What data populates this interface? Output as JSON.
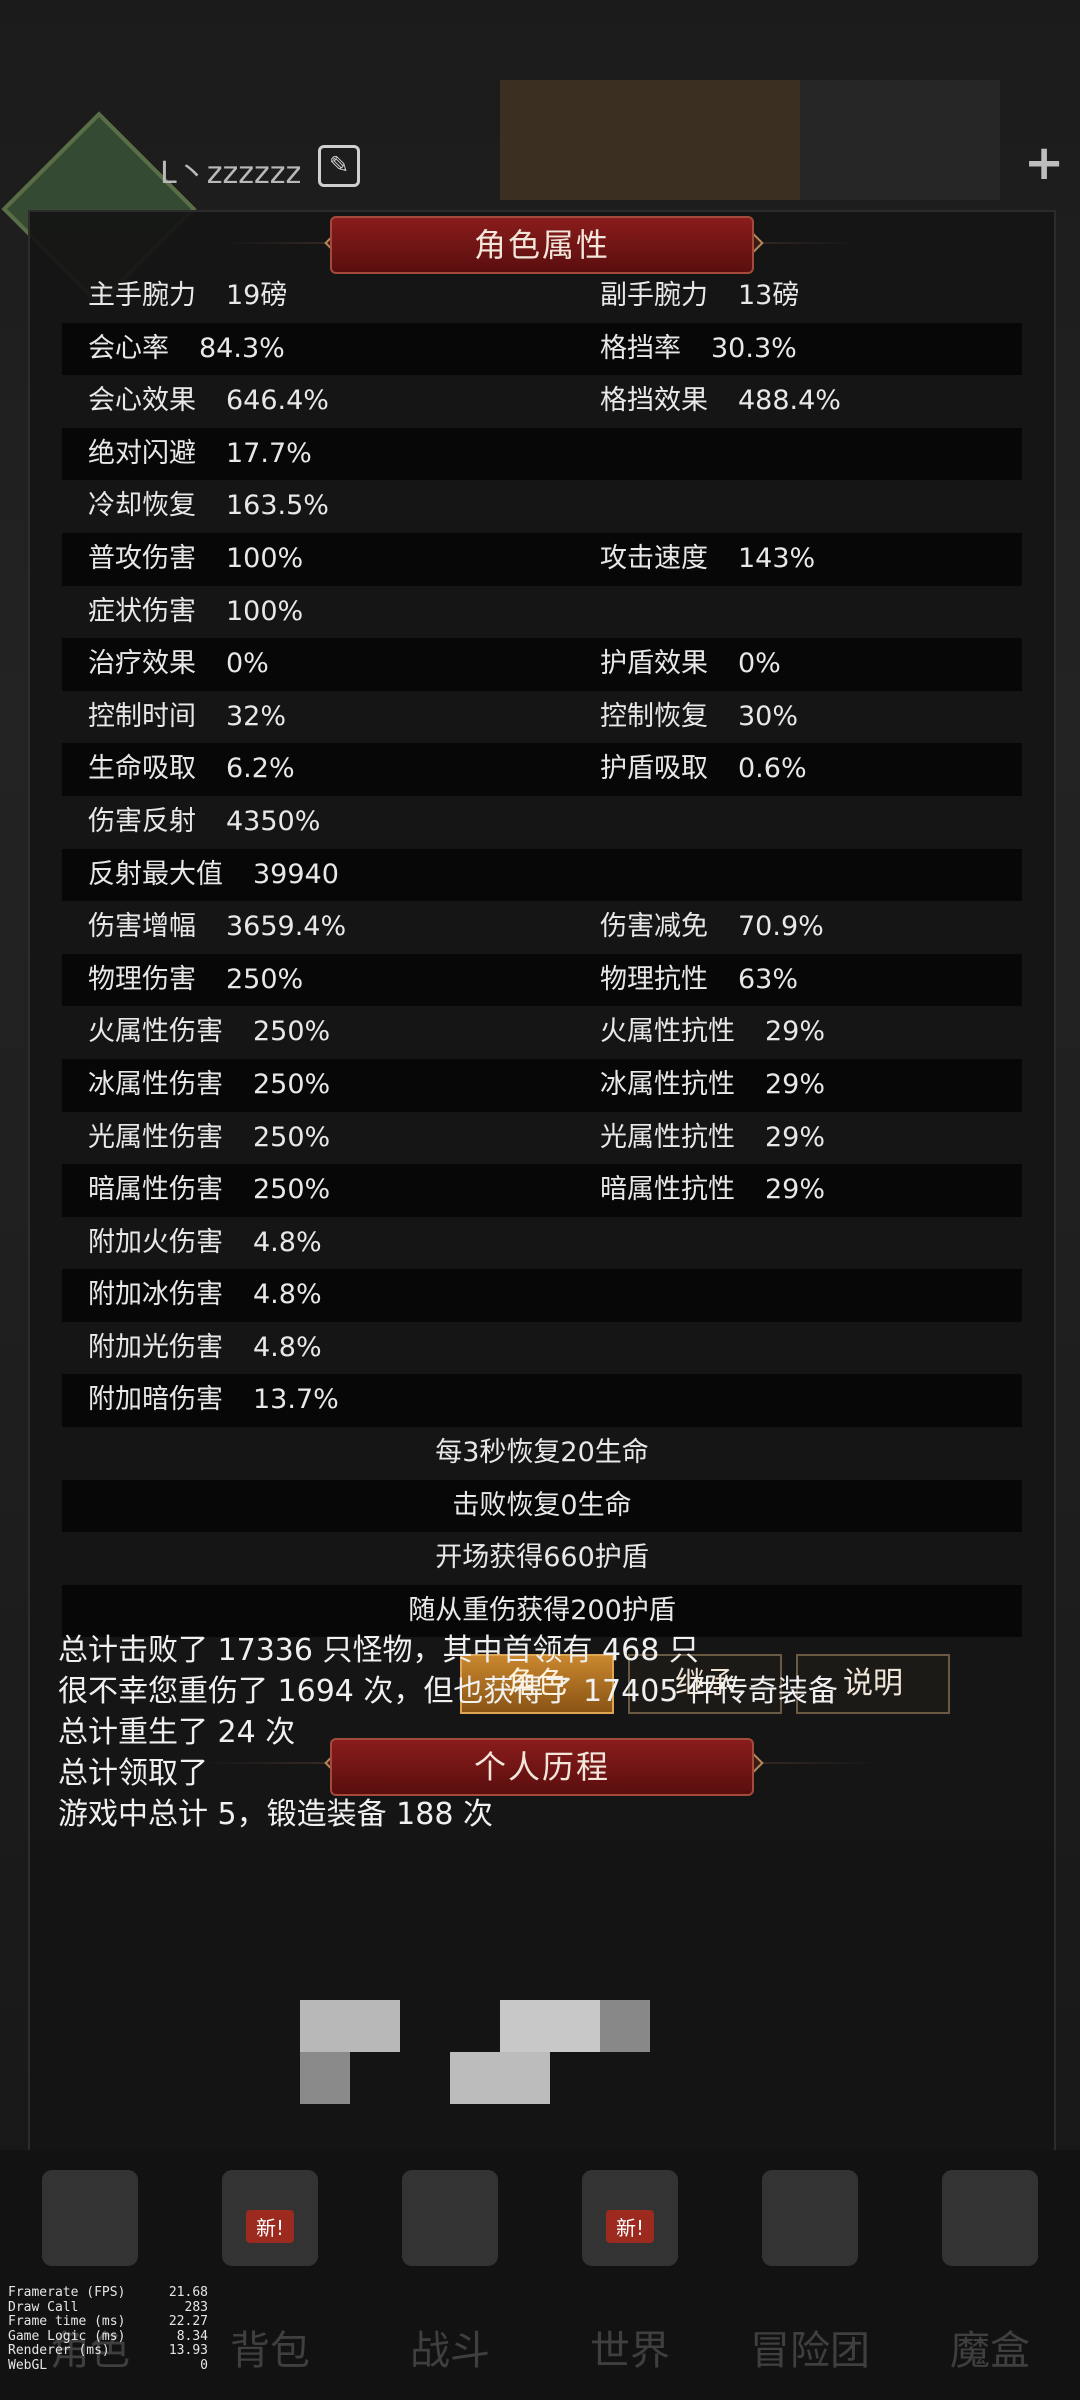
{
  "header": {
    "player_name": "L丶zzzzzz"
  },
  "attributes_panel": {
    "title": "角色属性",
    "rows": [
      {
        "l_label": "主手腕力",
        "l_val": "19磅",
        "r_label": "副手腕力",
        "r_val": "13磅"
      },
      {
        "l_label": "会心率",
        "l_val": "84.3%",
        "r_label": "格挡率",
        "r_val": "30.3%"
      },
      {
        "l_label": "会心效果",
        "l_val": "646.4%",
        "r_label": "格挡效果",
        "r_val": "488.4%"
      },
      {
        "l_label": "绝对闪避",
        "l_val": "17.7%",
        "r_label": "",
        "r_val": ""
      },
      {
        "l_label": "冷却恢复",
        "l_val": "163.5%",
        "r_label": "",
        "r_val": ""
      },
      {
        "l_label": "普攻伤害",
        "l_val": "100%",
        "r_label": "攻击速度",
        "r_val": "143%"
      },
      {
        "l_label": "症状伤害",
        "l_val": "100%",
        "r_label": "",
        "r_val": ""
      },
      {
        "l_label": "治疗效果",
        "l_val": "0%",
        "r_label": "护盾效果",
        "r_val": "0%"
      },
      {
        "l_label": "控制时间",
        "l_val": "32%",
        "r_label": "控制恢复",
        "r_val": "30%"
      },
      {
        "l_label": "生命吸取",
        "l_val": "6.2%",
        "r_label": "护盾吸取",
        "r_val": "0.6%"
      },
      {
        "l_label": "伤害反射",
        "l_val": "4350%",
        "r_label": "",
        "r_val": ""
      },
      {
        "l_label": "反射最大值",
        "l_val": "39940",
        "r_label": "",
        "r_val": ""
      },
      {
        "l_label": "伤害增幅",
        "l_val": "3659.4%",
        "r_label": "伤害减免",
        "r_val": "70.9%"
      },
      {
        "l_label": "物理伤害",
        "l_val": "250%",
        "r_label": "物理抗性",
        "r_val": "63%"
      },
      {
        "l_label": "火属性伤害",
        "l_val": "250%",
        "r_label": "火属性抗性",
        "r_val": "29%"
      },
      {
        "l_label": "冰属性伤害",
        "l_val": "250%",
        "r_label": "冰属性抗性",
        "r_val": "29%"
      },
      {
        "l_label": "光属性伤害",
        "l_val": "250%",
        "r_label": "光属性抗性",
        "r_val": "29%"
      },
      {
        "l_label": "暗属性伤害",
        "l_val": "250%",
        "r_label": "暗属性抗性",
        "r_val": "29%"
      },
      {
        "l_label": "附加火伤害",
        "l_val": "4.8%",
        "r_label": "",
        "r_val": ""
      },
      {
        "l_label": "附加冰伤害",
        "l_val": "4.8%",
        "r_label": "",
        "r_val": ""
      },
      {
        "l_label": "附加光伤害",
        "l_val": "4.8%",
        "r_label": "",
        "r_val": ""
      },
      {
        "l_label": "附加暗伤害",
        "l_val": "13.7%",
        "r_label": "",
        "r_val": ""
      }
    ],
    "centered_rows": [
      "每3秒恢复20生命",
      "击败恢复0生命",
      "开场获得660护盾",
      "随从重伤获得200护盾"
    ]
  },
  "tabs": [
    {
      "label": "角色",
      "active": true
    },
    {
      "label": "继承",
      "active": false
    },
    {
      "label": "说明",
      "active": false
    }
  ],
  "history": {
    "title": "个人历程",
    "lines": [
      "总计击败了 17336 只怪物，其中首领有 468 只",
      "很不幸您重伤了 1694 次，但也获得了 17405 件传奇装备",
      "总计重生了 24 次",
      "总计领取了",
      "游戏中总计                     5，锻造装备 188 次"
    ]
  },
  "bottom_nav": [
    {
      "label": "角色",
      "icon": "helmet-icon",
      "badge": ""
    },
    {
      "label": "背包",
      "icon": "backpack-icon",
      "badge": "新!"
    },
    {
      "label": "战斗",
      "icon": "sword-shield-icon",
      "badge": ""
    },
    {
      "label": "世界",
      "icon": "scroll-map-icon",
      "badge": "新!"
    },
    {
      "label": "冒险团",
      "icon": "castle-icon",
      "badge": ""
    },
    {
      "label": "魔盒",
      "icon": "cube-icon",
      "badge": ""
    }
  ],
  "debug_overlay": [
    {
      "label": "Framerate (FPS)",
      "value": "21.68"
    },
    {
      "label": "Draw Call",
      "value": "283"
    },
    {
      "label": "Frame time (ms)",
      "value": "22.27"
    },
    {
      "label": "Game Logic (ms)",
      "value": "8.34"
    },
    {
      "label": "Renderer (ms)",
      "value": "13.93"
    },
    {
      "label": "WebGL",
      "value": "0"
    }
  ]
}
